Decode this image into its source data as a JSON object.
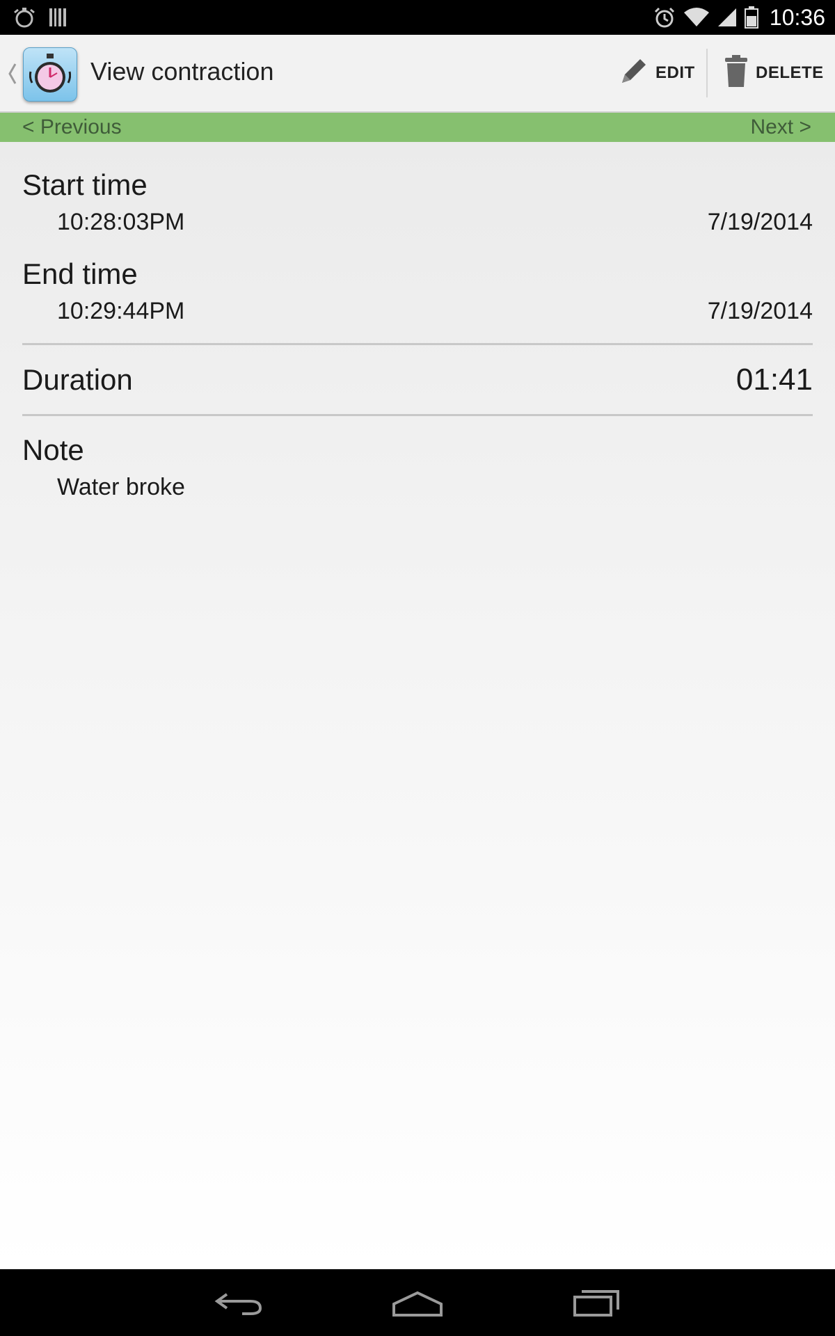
{
  "status_bar": {
    "time": "10:36",
    "left_icons": [
      "stopwatch-icon",
      "barcode-icon"
    ],
    "right_icons": [
      "alarm-icon",
      "wifi-icon",
      "signal-icon",
      "battery-icon"
    ]
  },
  "action_bar": {
    "title": "View contraction",
    "edit_label": "EDIT",
    "delete_label": "DELETE"
  },
  "nav": {
    "previous_label": "< Previous",
    "next_label": "Next >",
    "strip_color": "#86c06f"
  },
  "details": {
    "start": {
      "label": "Start time",
      "time": "10:28:03PM",
      "date": "7/19/2014"
    },
    "end": {
      "label": "End time",
      "time": "10:29:44PM",
      "date": "7/19/2014"
    },
    "duration": {
      "label": "Duration",
      "value": "01:41"
    },
    "note": {
      "label": "Note",
      "value": "Water broke"
    }
  },
  "system_nav": [
    "back-icon",
    "home-icon",
    "recents-icon"
  ]
}
